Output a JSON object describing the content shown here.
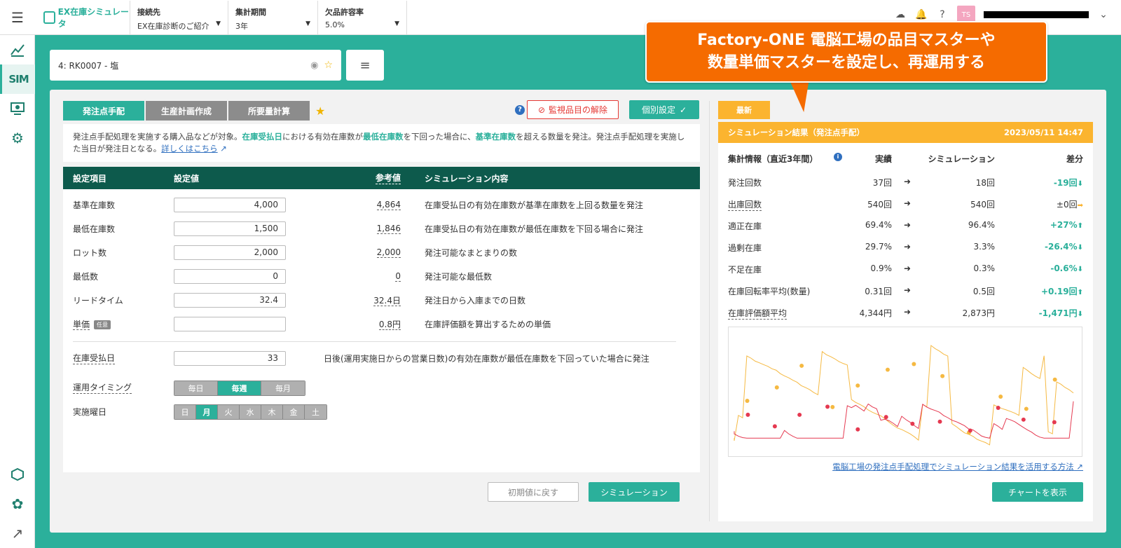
{
  "app": {
    "name": "EX在庫シミュレータ"
  },
  "header": {
    "connection": {
      "label": "接続先",
      "value": "EX在庫診断のご紹介"
    },
    "period": {
      "label": "集計期間",
      "value": "3年"
    },
    "stockout": {
      "label": "欠品許容率",
      "value": "5.0%"
    },
    "avatar_initials": "TS"
  },
  "item_search": {
    "value": "4: RK0007 - 塩"
  },
  "callout": {
    "line1": "Factory-ONE 電脳工場の品目マスターや",
    "line2": "数量単価マスターを設定し、再運用する"
  },
  "tabs": [
    {
      "label": "発注点手配",
      "active": true
    },
    {
      "label": "生産計画作成",
      "active": false
    },
    {
      "label": "所要量計算",
      "active": false
    }
  ],
  "buttons": {
    "unmonitor": "監視品目の解除",
    "individual": "個別設定",
    "reset": "初期値に戻す",
    "simulate": "シミュレーション",
    "show_chart": "チャートを表示"
  },
  "description": {
    "t1": "発注点手配処理を実施する購入品などが対象。",
    "e1": "在庫受払日",
    "t2": "における有効在庫数が",
    "e2": "最低在庫数",
    "t3": "を下回った場合に、",
    "e3": "基準在庫数",
    "t4": "を超える数量を発注。発注点手配処理を実施した当日が発注日となる。",
    "link": "詳しくはこちら"
  },
  "settings_header": {
    "item": "設定項目",
    "value": "設定値",
    "ref": "参考値",
    "sim": "シミュレーション内容"
  },
  "settings": [
    {
      "name": "基準在庫数",
      "value": "4,000",
      "ref": "4,864",
      "sim": "在庫受払日の有効在庫数が基準在庫数を上回る数量を発注"
    },
    {
      "name": "最低在庫数",
      "value": "1,500",
      "ref": "1,846",
      "sim": "在庫受払日の有効在庫数が最低在庫数を下回る場合に発注"
    },
    {
      "name": "ロット数",
      "value": "2,000",
      "ref": "2,000",
      "sim": "発注可能なまとまりの数"
    },
    {
      "name": "最低数",
      "value": "0",
      "ref": "0",
      "sim": "発注可能な最低数"
    },
    {
      "name": "リードタイム",
      "value": "32.4",
      "ref": "32.4日",
      "sim": "発注日から入庫までの日数"
    },
    {
      "name": "単価",
      "badge": "任意",
      "value": "",
      "ref": "0.8円",
      "sim": "在庫評価額を算出するための単価"
    }
  ],
  "receipt": {
    "name": "在庫受払日",
    "value": "33",
    "sim": "日後(運用実施日からの営業日数)の有効在庫数が最低在庫数を下回っていた場合に発注"
  },
  "timing": {
    "name": "運用タイミング",
    "options": [
      "毎日",
      "毎週",
      "毎月"
    ],
    "selected": "毎週"
  },
  "weekday": {
    "name": "実施曜日",
    "options": [
      "日",
      "月",
      "火",
      "水",
      "木",
      "金",
      "土"
    ],
    "selected": "月"
  },
  "result": {
    "tag": "最新",
    "title": "シミュレーション結果（発注点手配）",
    "date": "2023/05/11 14:47",
    "header": {
      "label": "集計情報（直近3年間）",
      "actual": "実績",
      "sim": "シミュレーション",
      "diff": "差分"
    },
    "rows": [
      {
        "label": "発注回数",
        "actual": "37回",
        "sim": "18回",
        "diff": "-19回",
        "trend": "down"
      },
      {
        "label": "出庫回数",
        "actual": "540回",
        "sim": "540回",
        "diff": "±0回",
        "trend": "flat",
        "dash": true
      },
      {
        "label": "適正在庫",
        "actual": "69.4%",
        "sim": "96.4%",
        "diff": "+27%",
        "trend": "up"
      },
      {
        "label": "過剰在庫",
        "actual": "29.7%",
        "sim": "3.3%",
        "diff": "-26.4%",
        "trend": "down"
      },
      {
        "label": "不足在庫",
        "actual": "0.9%",
        "sim": "0.3%",
        "diff": "-0.6%",
        "trend": "down"
      },
      {
        "label": "在庫回転率平均(数量)",
        "actual": "0.31回",
        "sim": "0.5回",
        "diff": "+0.19回",
        "trend": "up"
      },
      {
        "label": "在庫評価額平均",
        "actual": "4,344円",
        "sim": "2,873円",
        "diff": "-1,471円",
        "trend": "down",
        "dash": true
      }
    ],
    "link": "電脳工場の発注点手配処理でシミュレーション結果を活用する方法"
  },
  "colors": {
    "accent": "#2bb09b",
    "dark": "#0d5a4c",
    "orange": "#f56b00",
    "yellow": "#fbb42f",
    "red": "#e53935"
  }
}
